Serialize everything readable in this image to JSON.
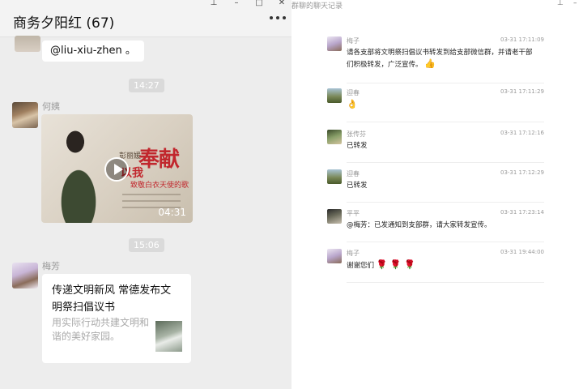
{
  "chat": {
    "title": "商务夕阳红 (67)",
    "mention_text": "@liu-xiu-zhen 。",
    "time_1": "14:27",
    "time_2": "15:06",
    "video_sender": "何姨",
    "video": {
      "overlay_title": "奉献",
      "overlay_title_2": "以我",
      "overlay_subtitle": "致敬白衣天使的歌",
      "singer": "彭丽媛",
      "duration": "04:31"
    },
    "link_sender": "梅芳",
    "link_card": {
      "title": "传递文明新风 常德发布文明祭扫倡议书",
      "description": "用实际行动共建文明和谐的美好家园。"
    }
  },
  "history": {
    "title": "群聊的聊天记录",
    "records": [
      {
        "name": "梅子",
        "time": "03-31 17:11:09",
        "text": "请各支部将文明祭扫倡议书转发到给支部微信群，并请老干部们积极转发，广泛宣传。",
        "emoji": "👍"
      },
      {
        "name": "迎春",
        "time": "03-31 17:11:29",
        "text": "",
        "emoji": "👌"
      },
      {
        "name": "张传芬",
        "time": "03-31 17:12:16",
        "text": "已转发",
        "emoji": ""
      },
      {
        "name": "迎春",
        "time": "03-31 17:12:29",
        "text": "已转发",
        "emoji": ""
      },
      {
        "name": "平平",
        "time": "03-31 17:23:14",
        "text": "@梅芳：已发通知到支部群，请大家转发宣传。",
        "emoji": ""
      },
      {
        "name": "梅子",
        "time": "03-31 19:44:00",
        "text": "谢谢您们",
        "emoji": "🌹 🌹 🌹"
      }
    ]
  },
  "icons": [
    "pin-icon",
    "minimize-icon",
    "maximize-icon",
    "close-icon",
    "more-icon",
    "play-icon"
  ]
}
